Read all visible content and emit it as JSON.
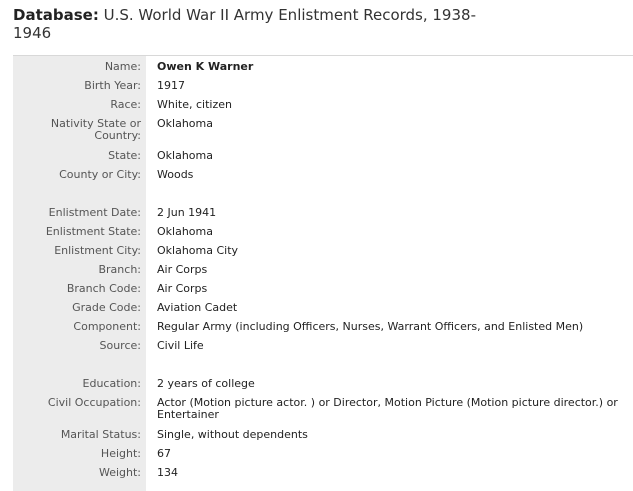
{
  "header": {
    "label": "Database:",
    "title": "U.S. World War II Army Enlistment Records, 1938-1946"
  },
  "fields": [
    {
      "label": "Name:",
      "value": "Owen K Warner"
    },
    {
      "label": "Birth Year:",
      "value": "1917"
    },
    {
      "label": "Race:",
      "value": "White, citizen"
    },
    {
      "label": "Nativity State or Country:",
      "value": "Oklahoma"
    },
    {
      "label": "State:",
      "value": "Oklahoma"
    },
    {
      "label": "County or City:",
      "value": "Woods"
    },
    {
      "label": "Enlistment Date:",
      "value": "2 Jun 1941"
    },
    {
      "label": "Enlistment State:",
      "value": "Oklahoma"
    },
    {
      "label": "Enlistment City:",
      "value": "Oklahoma City"
    },
    {
      "label": "Branch:",
      "value": "Air Corps"
    },
    {
      "label": "Branch Code:",
      "value": "Air Corps"
    },
    {
      "label": "Grade Code:",
      "value": "Aviation Cadet"
    },
    {
      "label": "Component:",
      "value": "Regular Army (including Officers, Nurses, Warrant Officers, and Enlisted Men)"
    },
    {
      "label": "Source:",
      "value": "Civil Life"
    },
    {
      "label": "Education:",
      "value": "2 years of college"
    },
    {
      "label": "Civil Occupation:",
      "value": "Actor (Motion picture actor. ) or Director, Motion Picture (Motion picture director.) or Entertainer"
    },
    {
      "label": "Marital Status:",
      "value": "Single, without dependents"
    },
    {
      "label": "Height:",
      "value": "67"
    },
    {
      "label": "Weight:",
      "value": "134"
    }
  ]
}
